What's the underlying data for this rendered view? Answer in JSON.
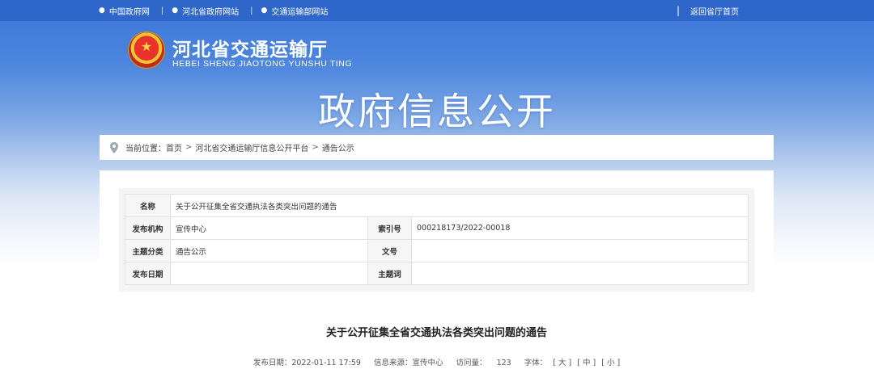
{
  "topbar": {
    "links": [
      "中国政府网",
      "河北省政府网站",
      "交通运输部网站"
    ],
    "home_link": "返回省厅首页"
  },
  "header": {
    "title_cn": "河北省交通运输厅",
    "title_en": "HEBEI SHENG JIAOTONG YUNSHU TING",
    "banner": "政府信息公开"
  },
  "breadcrumb": {
    "prefix": "当前位置：",
    "items": [
      "首页",
      "河北省交通运输厅信息公开平台",
      "通告公示"
    ]
  },
  "meta": {
    "name_label": "名称",
    "name_value": "关于公开征集全省交通执法各类突出问题的通告",
    "org_label": "发布机构",
    "org_value": "宣传中心",
    "index_label": "索引号",
    "index_value": "000218173/2022-00018",
    "topic_label": "主题分类",
    "topic_value": "通告公示",
    "docno_label": "文号",
    "docno_value": "",
    "date_label": "发布日期",
    "date_value": "",
    "keyword_label": "主题词",
    "keyword_value": ""
  },
  "article": {
    "title": "关于公开征集全省交通执法各类突出问题的通告",
    "publish_date": "发布日期：2022-01-11 17:59",
    "source": "信息来源：宣传中心",
    "visits_label": "访问量：",
    "visits": "123",
    "font_label": "字体：",
    "font_large": "[ 大 ]",
    "font_medium": "[ 中 ]",
    "font_small": "[ 小 ]"
  },
  "colors": {
    "topbar": "#2f66c9",
    "banner_top": "#3a74d8",
    "text": "#333333"
  }
}
